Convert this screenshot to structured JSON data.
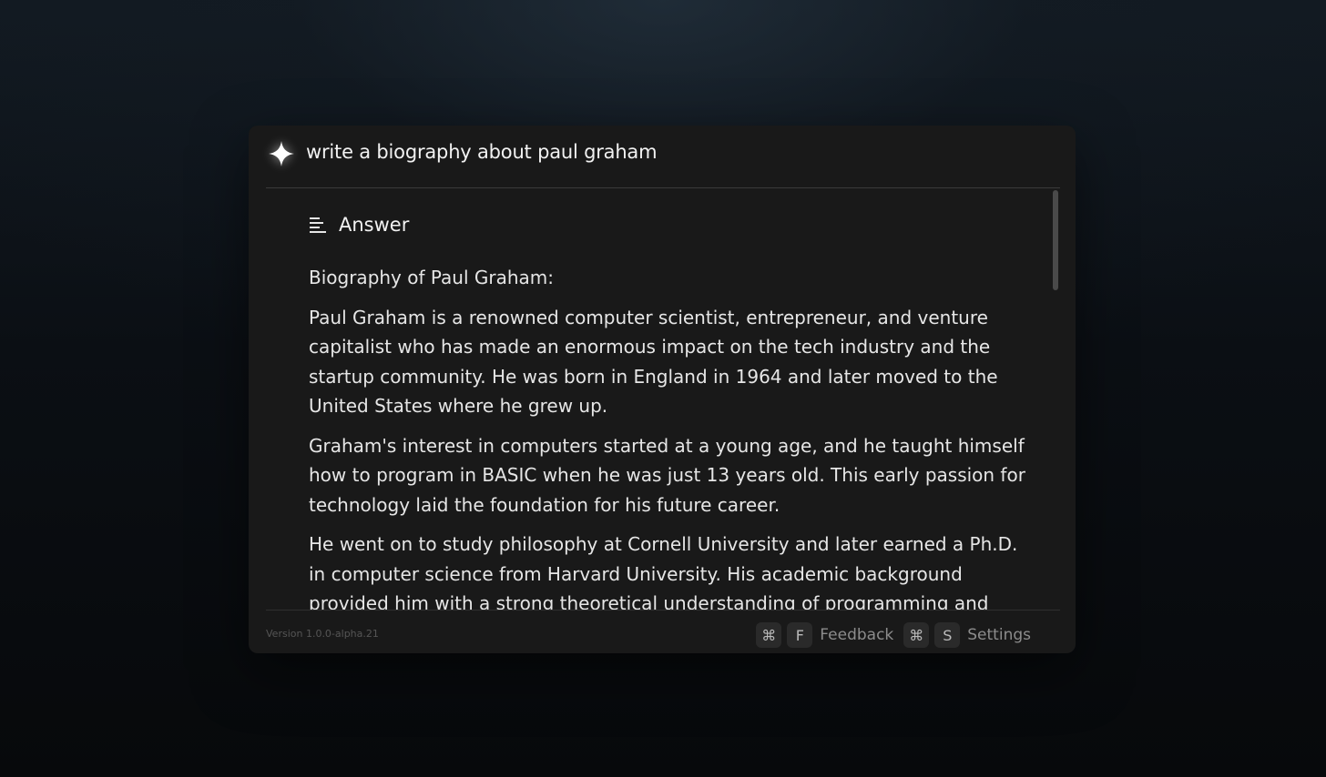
{
  "query": {
    "icon": "sparkle-icon",
    "text": "write a biography about paul graham"
  },
  "answer": {
    "icon": "align-left-icon",
    "heading": "Answer",
    "paragraphs": [
      "Biography of Paul Graham:",
      "Paul Graham is a renowned computer scientist, entrepreneur, and venture capitalist who has made an enormous impact on the tech industry and the startup community. He was born in England in 1964 and later moved to the United States where he grew up.",
      "Graham's interest in computers started at a young age, and he taught himself how to program in BASIC when he was just 13 years old. This early passion for technology laid the foundation for his future career.",
      "He went on to study philosophy at Cornell University and later earned a Ph.D. in computer science from Harvard University. His academic background provided him with a strong theoretical understanding of programming and"
    ]
  },
  "footer": {
    "version": "Version 1.0.0-alpha.21",
    "shortcuts": [
      {
        "modifier": "⌘",
        "key": "F",
        "label": "Feedback"
      },
      {
        "modifier": "⌘",
        "key": "S",
        "label": "Settings"
      }
    ]
  }
}
